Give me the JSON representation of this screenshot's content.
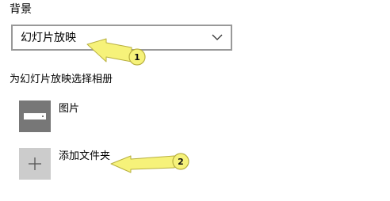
{
  "background": {
    "label": "背景",
    "dropdown_value": "幻灯片放映"
  },
  "album": {
    "heading": "为幻灯片放映选择相册",
    "items": [
      {
        "label": "图片",
        "icon": "picture-icon"
      },
      {
        "label": "添加文件夹",
        "icon": "plus-icon"
      }
    ]
  },
  "callouts": [
    "1",
    "2"
  ],
  "colors": {
    "callout_fill": "#f6f27a",
    "callout_stroke": "#b8b040",
    "tile_dark": "#777777",
    "tile_light": "#cccccc",
    "select_border": "#999999"
  }
}
